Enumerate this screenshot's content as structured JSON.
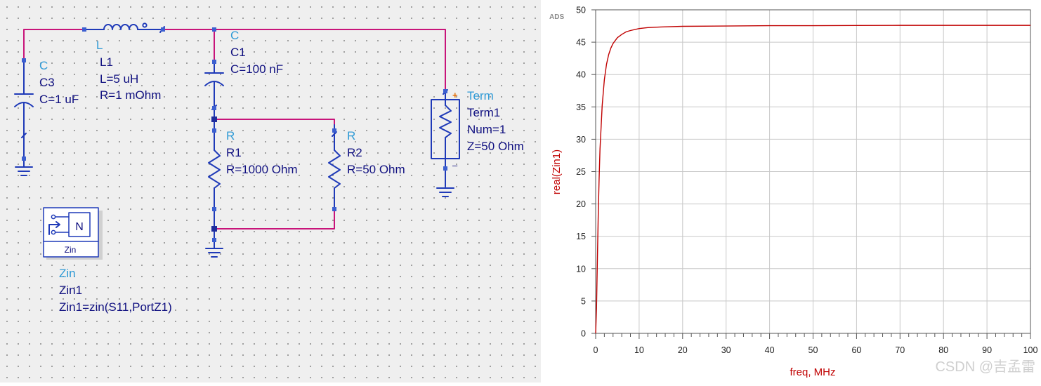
{
  "schematic": {
    "inductor": {
      "type": "L",
      "name": "L1",
      "value": "L=5 uH",
      "resistance": "R=1 mOhm"
    },
    "cap_c3": {
      "type": "C",
      "name": "C3",
      "value": "C=1 uF"
    },
    "cap_c1": {
      "type": "C",
      "name": "C1",
      "value": "C=100 nF"
    },
    "res_r1": {
      "type": "R",
      "name": "R1",
      "value": "R=1000 Ohm"
    },
    "res_r2": {
      "type": "R",
      "name": "R2",
      "value": "R=50 Ohm"
    },
    "term": {
      "type": "Term",
      "name": "Term1",
      "num": "Num=1",
      "z": "Z=50 Ohm",
      "plus": "+",
      "minus": "–"
    },
    "zin": {
      "icon_letter": "N",
      "box_label": "Zin",
      "type": "Zin",
      "name": "Zin1",
      "equation": "Zin1=zin(S11,PortZ1)"
    }
  },
  "colors": {
    "wire": "#c8147a",
    "component": "#1f3ab8",
    "trace": "#c00000",
    "grid": "#c8c8c8"
  },
  "chart_data": {
    "type": "line",
    "corner_label": "ADS",
    "xlabel": "freq, MHz",
    "ylabel": "real(Zin1)",
    "xlim": [
      0,
      100
    ],
    "ylim": [
      0,
      50
    ],
    "xticks": [
      0,
      10,
      20,
      30,
      40,
      50,
      60,
      70,
      80,
      90,
      100
    ],
    "yticks": [
      0,
      5,
      10,
      15,
      20,
      25,
      30,
      35,
      40,
      45,
      50
    ],
    "grid": true,
    "series": [
      {
        "x": [
          0,
          0.2,
          0.4,
          0.6,
          0.8,
          1.0,
          1.5,
          2.0,
          2.5,
          3.0,
          3.5,
          4.0,
          5.0,
          6.0,
          7.0,
          8.0,
          10.0,
          12.0,
          15.0,
          20.0,
          30.0,
          40.0,
          50.0,
          60.0,
          70.0,
          80.0,
          90.0,
          100.0
        ],
        "y": [
          0,
          4.0,
          11.5,
          18.5,
          24.0,
          28.5,
          35.2,
          39.2,
          41.6,
          43.1,
          44.1,
          44.8,
          45.7,
          46.2,
          46.6,
          46.8,
          47.1,
          47.25,
          47.35,
          47.45,
          47.5,
          47.55,
          47.55,
          47.58,
          47.6,
          47.6,
          47.6,
          47.6
        ]
      }
    ]
  },
  "watermark": "CSDN @吉孟雷"
}
